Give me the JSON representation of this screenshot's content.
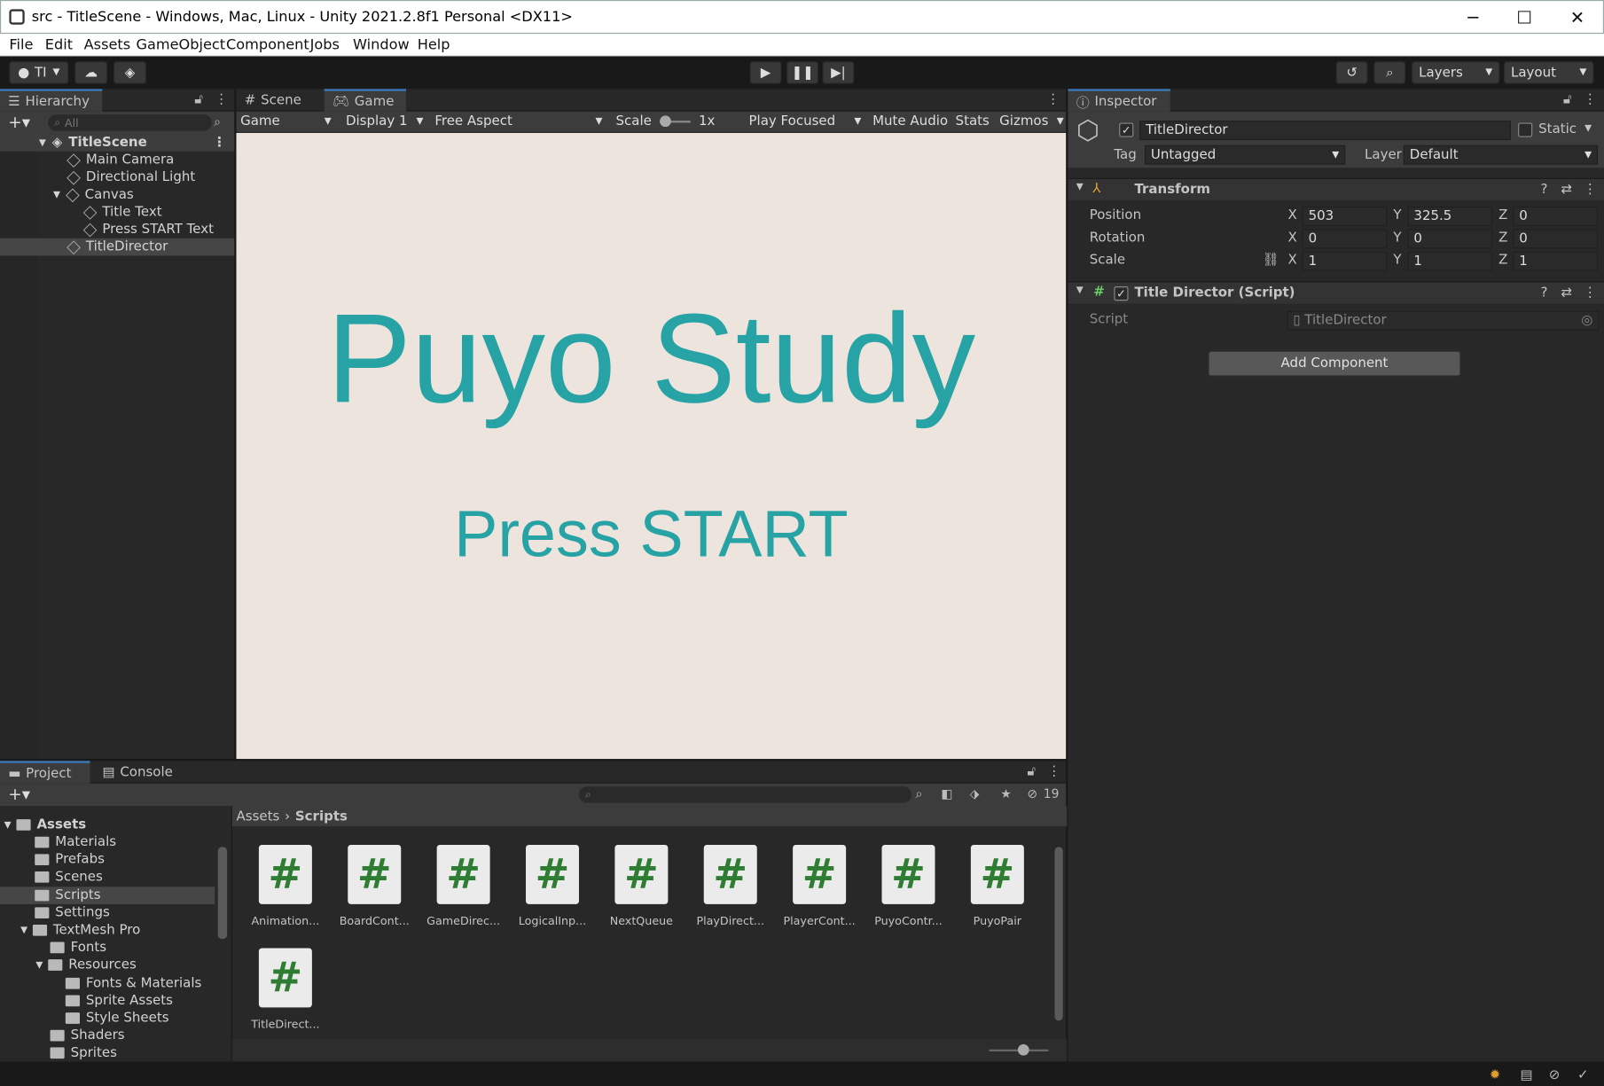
{
  "window": {
    "title": "src - TitleScene - Windows, Mac, Linux - Unity 2021.2.8f1 Personal <DX11>",
    "minimize": "─",
    "maximize": "☐",
    "close": "✕"
  },
  "menu": [
    "File",
    "Edit",
    "Assets",
    "GameObject",
    "Component",
    "Jobs",
    "Window",
    "Help"
  ],
  "toolbar": {
    "account": "TI",
    "layers": "Layers",
    "layout": "Layout"
  },
  "hierarchy": {
    "tab": "Hierarchy",
    "search_placeholder": "All",
    "scene": "TitleScene",
    "items": [
      "Main Camera",
      "Directional Light",
      "Canvas",
      "Title Text",
      "Press START Text",
      "TitleDirector"
    ]
  },
  "game": {
    "tabs": [
      "Scene",
      "Game"
    ],
    "mode": "Game",
    "display": "Display 1",
    "aspect": "Free Aspect",
    "scale_label": "Scale",
    "scale_value": "1x",
    "play_focused": "Play Focused",
    "mute": "Mute Audio",
    "stats": "Stats",
    "gizmos": "Gizmos",
    "title_text": "Puyo Study",
    "press_text": "Press START"
  },
  "inspector": {
    "tab": "Inspector",
    "object_name": "TitleDirector",
    "static_label": "Static",
    "tag_label": "Tag",
    "tag_value": "Untagged",
    "layer_label": "Layer",
    "layer_value": "Default",
    "transform": {
      "header": "Transform",
      "position_label": "Position",
      "rotation_label": "Rotation",
      "scale_label": "Scale",
      "axes": [
        "X",
        "Y",
        "Z"
      ],
      "position": [
        "503",
        "325.5",
        "0"
      ],
      "rotation": [
        "0",
        "0",
        "0"
      ],
      "scale": [
        "1",
        "1",
        "1"
      ]
    },
    "script_component": {
      "header": "Title Director (Script)",
      "script_label": "Script",
      "script_value": "TitleDirector"
    },
    "add_component": "Add Component"
  },
  "project": {
    "tabs": [
      "Project",
      "Console"
    ],
    "hidden_count": "19",
    "breadcrumb": [
      "Assets",
      "Scripts"
    ],
    "tree": [
      "Assets",
      "Materials",
      "Prefabs",
      "Scenes",
      "Scripts",
      "Settings",
      "TextMesh Pro",
      "Fonts",
      "Resources",
      "Fonts & Materials",
      "Sprite Assets",
      "Style Sheets",
      "Shaders",
      "Sprites"
    ],
    "assets": [
      "Animation...",
      "BoardCont...",
      "GameDirec...",
      "LogicalInp...",
      "NextQueue",
      "PlayDirect...",
      "PlayerCont...",
      "PuyoContr...",
      "PuyoPair",
      "TitleDirect..."
    ]
  }
}
